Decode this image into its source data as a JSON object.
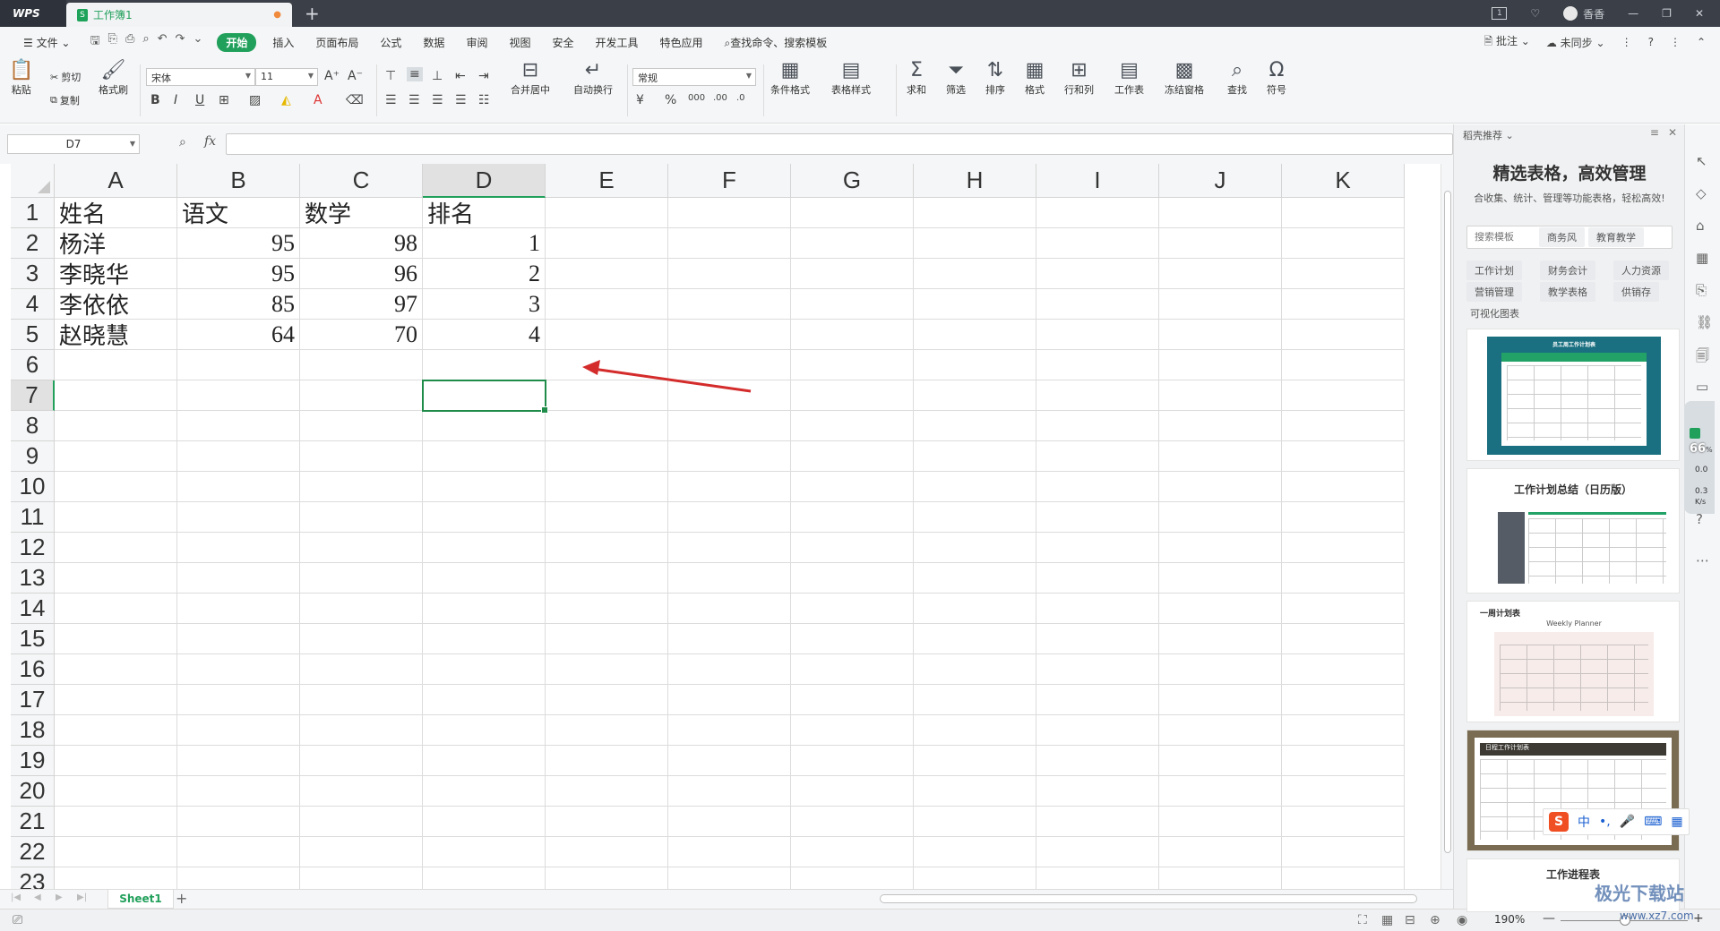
{
  "titlebar": {
    "app_logo": "WPS",
    "tab_title": "工作簿1",
    "user_name": "香香",
    "badge": "1"
  },
  "menubar": {
    "file_label": "文件",
    "tabs": [
      "开始",
      "插入",
      "页面布局",
      "公式",
      "数据",
      "审阅",
      "视图",
      "安全",
      "开发工具",
      "特色应用"
    ],
    "search_label": "查找命令、搜索模板",
    "annotate_label": "批注",
    "sync_label": "未同步"
  },
  "ribbon": {
    "paste": "粘贴",
    "cut": "剪切",
    "copy": "复制",
    "format_painter": "格式刷",
    "font_name": "宋体",
    "font_size": "11",
    "merge": "合并居中",
    "wrap": "自动换行",
    "number_format": "常规",
    "cond_format": "条件格式",
    "table_style": "表格样式",
    "sum": "求和",
    "filter": "筛选",
    "sort": "排序",
    "format": "格式",
    "rowcol": "行和列",
    "worksheet": "工作表",
    "freeze": "冻结窗格",
    "find": "查找",
    "symbol": "符号"
  },
  "formula_bar": {
    "cell_ref": "D7",
    "fx": "fx",
    "formula": ""
  },
  "sheet": {
    "columns": [
      "A",
      "B",
      "C",
      "D",
      "E",
      "F",
      "G",
      "H",
      "I",
      "J",
      "K"
    ],
    "rows": [
      "1",
      "2",
      "3",
      "4",
      "5",
      "6",
      "7",
      "8",
      "9",
      "10",
      "11",
      "12",
      "13",
      "14",
      "15",
      "16",
      "17",
      "18",
      "19",
      "20",
      "21",
      "22",
      "23"
    ],
    "cells": [
      [
        "姓名",
        "语文",
        "数学",
        "排名"
      ],
      [
        "杨洋",
        "95",
        "98",
        "1"
      ],
      [
        "李晓华",
        "95",
        "96",
        "2"
      ],
      [
        "李依依",
        "85",
        "97",
        "3"
      ],
      [
        "赵晓慧",
        "64",
        "70",
        "4"
      ]
    ],
    "selected_cell": "D7",
    "tab_name": "Sheet1"
  },
  "right_panel": {
    "header": "稻壳推荐",
    "title": "精选表格，高效管理",
    "subtitle": "合收集、统计、管理等功能表格，轻松高效!",
    "search_placeholder": "搜索模板",
    "search_chips": [
      "商务风",
      "教育教学"
    ],
    "categories": [
      "工作计划",
      "财务会计",
      "人力资源",
      "营销管理",
      "教学表格",
      "供销存"
    ],
    "section": "可视化图表",
    "cards": [
      "员工周工作计划表",
      "工作计划总结（日历版）",
      "一周计划表",
      "日程工作计划表",
      "工作进程表"
    ],
    "card3_sub": "Weekly Planner"
  },
  "sidebar": {
    "speed_value": "66",
    "speed_unit": "%",
    "up": "0.0",
    "down": "0.3",
    "rate_unit": "K/s"
  },
  "statusbar": {
    "zoom": "190%"
  },
  "ime": {
    "label": "中"
  },
  "watermark": {
    "text": "极光下载站",
    "url": "www.xz7.com"
  },
  "colors": {
    "accent": "#21a05b",
    "annotation_arrow": "#d42b2b"
  }
}
